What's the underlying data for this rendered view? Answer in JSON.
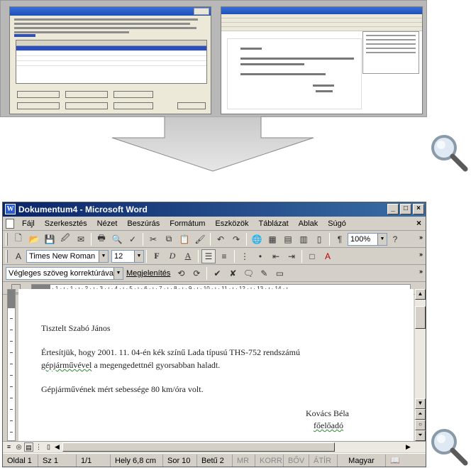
{
  "word": {
    "title": "Dokumentum4 - Microsoft Word",
    "window_buttons": [
      "_",
      "□",
      "×"
    ],
    "doc_close": "×",
    "menu": [
      "Fájl",
      "Szerkesztés",
      "Nézet",
      "Beszúrás",
      "Formátum",
      "Eszközök",
      "Táblázat",
      "Ablak",
      "Súgó"
    ],
    "formatting": {
      "font": "Times New Roman",
      "size": "12",
      "bold": "F",
      "italic": "D",
      "underline": "A"
    },
    "zoom": "100%",
    "reviewing": {
      "mode": "Végleges szöveg korrektúrával",
      "show": "Megjelenítés"
    },
    "ruler_text": "· 1 · ı · 1 · ı · 2 · ı · 3 · ı · 4 · ı · 5 · ı · 6 · ı · 7 · ı · 8 · ı · 9 · ı · 10 · ı · 11 · ı · 12 · ı · 13 · ı · 14 · ı",
    "document": {
      "greeting": "Tisztelt Szabó János",
      "para1_line1": "Értesítjük, hogy 2001. 11. 04-én kék színű Lada típusú THS-752 rendszámú",
      "para1_line2_squiggle": "gépjárművével",
      "para1_line2_rest": " a megengedettnél gyorsabban haladt.",
      "para2": "Gépjárművének mért sebessége 80 km/óra volt.",
      "signature_name": "Kovács Béla",
      "signature_title": "főelőadó"
    },
    "status": {
      "page": "Oldal 1",
      "section": "Sz 1",
      "pages": "1/1",
      "position": "Hely 6,8 cm",
      "line": "Sor 10",
      "column": "Betű 2",
      "rec": "MR",
      "trk": "KORR",
      "ext": "BŐV",
      "ovr": "ÁTÍR",
      "language": "Magyar"
    }
  },
  "icons": {
    "magnifier": "magnifier-icon",
    "arrow": "down-arrow-icon"
  },
  "colors": {
    "title_gradient_start": "#0a246a",
    "title_gradient_end": "#3a6ea5",
    "grammar_squiggle": "#2d8a2d",
    "band": "#b8b8b8"
  }
}
